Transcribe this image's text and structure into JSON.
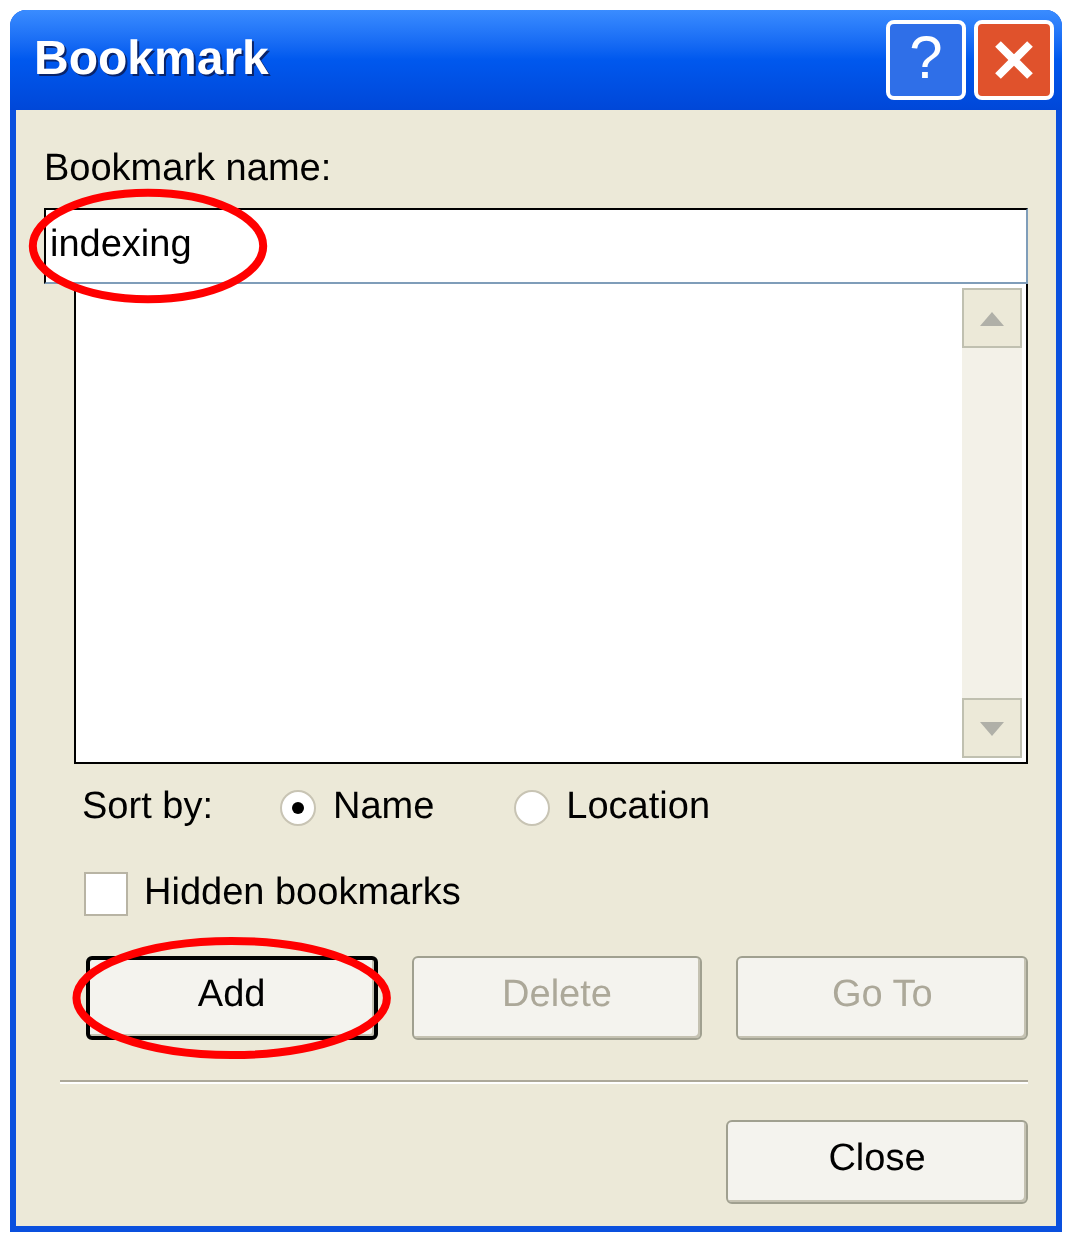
{
  "window": {
    "title": "Bookmark"
  },
  "title_buttons": [
    {
      "kind": "help",
      "label": "?"
    },
    {
      "kind": "close"
    }
  ],
  "name_field": {
    "label": "Bookmark name:",
    "value": "indexing",
    "circled": true
  },
  "sort": {
    "label": "Sort by:",
    "options": [
      {
        "label": "Name",
        "selected": true
      },
      {
        "label": "Location",
        "selected": false
      }
    ]
  },
  "hidden_bookmarks": {
    "label": "Hidden bookmarks",
    "checked": false
  },
  "buttons": [
    {
      "label": "Add",
      "disabled": false,
      "default": true,
      "circled": true
    },
    {
      "label": "Delete",
      "disabled": true,
      "default": false,
      "circled": false
    },
    {
      "label": "Go To",
      "disabled": true,
      "default": false,
      "circled": false
    }
  ],
  "close_button": {
    "label": "Close"
  }
}
